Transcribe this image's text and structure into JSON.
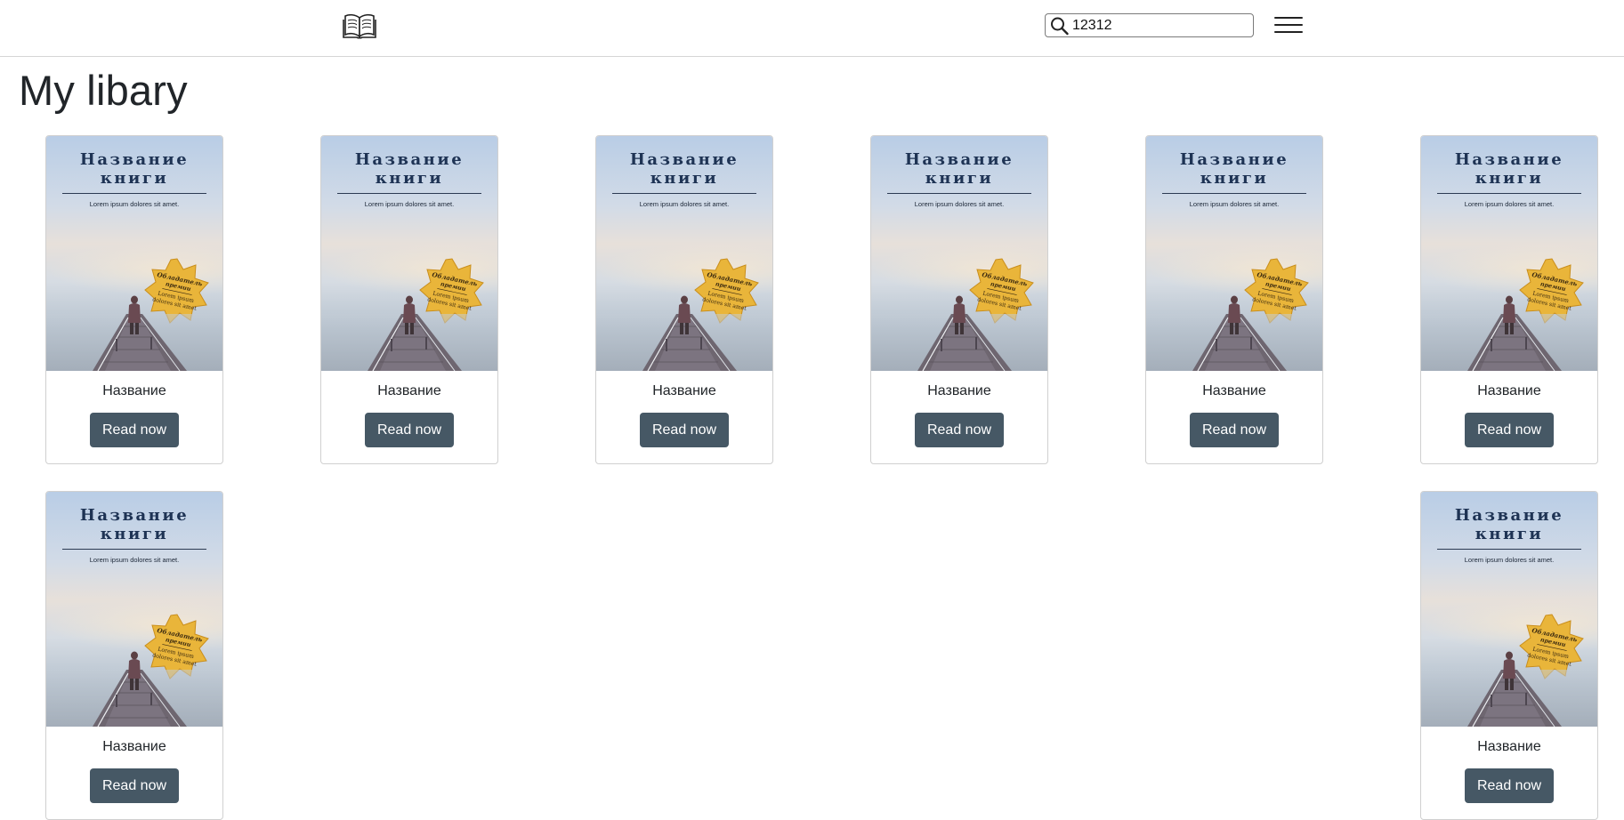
{
  "header": {
    "logo_icon": "open-book-icon",
    "search": {
      "icon": "search-icon",
      "value": "12312"
    },
    "menu_icon": "hamburger-menu-icon"
  },
  "page_title": "My libary",
  "books": [
    {
      "cover_title_line1": "Название",
      "cover_title_line2": "книги",
      "cover_subtitle": "Lorem ipsum dolores sit amet.",
      "badge_line1": "Обладатель",
      "badge_line2": "премии",
      "badge_line3": "Lorem ipsum",
      "badge_line4": "dolores sit amet",
      "name": "Название",
      "button": "Read now"
    },
    {
      "cover_title_line1": "Название",
      "cover_title_line2": "книги",
      "cover_subtitle": "Lorem ipsum dolores sit amet.",
      "badge_line1": "Обладатель",
      "badge_line2": "премии",
      "badge_line3": "Lorem ipsum",
      "badge_line4": "dolores sit amet",
      "name": "Название",
      "button": "Read now"
    },
    {
      "cover_title_line1": "Название",
      "cover_title_line2": "книги",
      "cover_subtitle": "Lorem ipsum dolores sit amet.",
      "badge_line1": "Обладатель",
      "badge_line2": "премии",
      "badge_line3": "Lorem ipsum",
      "badge_line4": "dolores sit amet",
      "name": "Название",
      "button": "Read now"
    },
    {
      "cover_title_line1": "Название",
      "cover_title_line2": "книги",
      "cover_subtitle": "Lorem ipsum dolores sit amet.",
      "badge_line1": "Обладатель",
      "badge_line2": "премии",
      "badge_line3": "Lorem ipsum",
      "badge_line4": "dolores sit amet",
      "name": "Название",
      "button": "Read now"
    },
    {
      "cover_title_line1": "Название",
      "cover_title_line2": "книги",
      "cover_subtitle": "Lorem ipsum dolores sit amet.",
      "badge_line1": "Обладатель",
      "badge_line2": "премии",
      "badge_line3": "Lorem ipsum",
      "badge_line4": "dolores sit amet",
      "name": "Название",
      "button": "Read now"
    },
    {
      "cover_title_line1": "Название",
      "cover_title_line2": "книги",
      "cover_subtitle": "Lorem ipsum dolores sit amet.",
      "badge_line1": "Обладатель",
      "badge_line2": "премии",
      "badge_line3": "Lorem ipsum",
      "badge_line4": "dolores sit amet",
      "name": "Название",
      "button": "Read now"
    },
    {
      "cover_title_line1": "Название",
      "cover_title_line2": "книги",
      "cover_subtitle": "Lorem ipsum dolores sit amet.",
      "badge_line1": "Обладатель",
      "badge_line2": "премии",
      "badge_line3": "Lorem ipsum",
      "badge_line4": "dolores sit amet",
      "name": "Название",
      "button": "Read now"
    },
    {
      "cover_title_line1": "Название",
      "cover_title_line2": "книги",
      "cover_subtitle": "Lorem ipsum dolores sit amet.",
      "badge_line1": "Обладатель",
      "badge_line2": "премии",
      "badge_line3": "Lorem ipsum",
      "badge_line4": "dolores sit amet",
      "name": "Название",
      "button": "Read now"
    }
  ],
  "colors": {
    "button_bg": "#465865",
    "button_text": "#ffffff",
    "cover_title": "#1e3354",
    "badge_gold": "#e9b53a"
  }
}
